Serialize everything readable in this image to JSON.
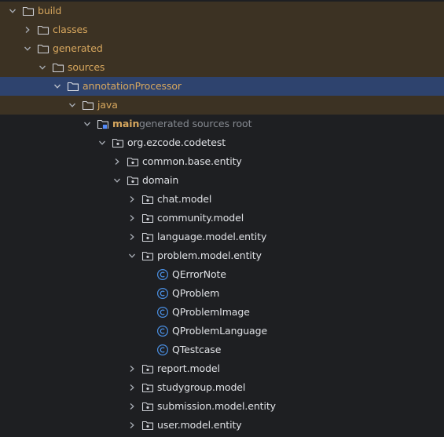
{
  "colors": {
    "background": "#1e1f22",
    "excluded_row": "#3c3223",
    "selected_row": "#2e436e",
    "excluded_text": "#d7a75e",
    "class_icon": "#4a8fe3",
    "hint_text": "#868a91"
  },
  "project_tree": {
    "build": {
      "label": "build",
      "icon": "folder-icon",
      "state": "expanded"
    },
    "classes": {
      "label": "classes",
      "icon": "folder-icon",
      "state": "collapsed"
    },
    "generated": {
      "label": "generated",
      "icon": "folder-icon",
      "state": "expanded"
    },
    "sources": {
      "label": "sources",
      "icon": "folder-icon",
      "state": "expanded"
    },
    "annotationProcessor": {
      "label": "annotationProcessor",
      "icon": "folder-icon",
      "state": "expanded",
      "selected": true
    },
    "java": {
      "label": "java",
      "icon": "folder-icon",
      "state": "expanded"
    },
    "main": {
      "label": "main",
      "hint": "generated sources root",
      "icon": "source-root-icon",
      "state": "expanded"
    },
    "org_ezcode_codetest": {
      "label": "org.ezcode.codetest",
      "icon": "package-icon",
      "state": "expanded"
    },
    "common_base_entity": {
      "label": "common.base.entity",
      "icon": "package-icon",
      "state": "collapsed"
    },
    "domain": {
      "label": "domain",
      "icon": "package-icon",
      "state": "expanded"
    },
    "chat_model": {
      "label": "chat.model",
      "icon": "package-icon",
      "state": "collapsed"
    },
    "community_model": {
      "label": "community.model",
      "icon": "package-icon",
      "state": "collapsed"
    },
    "language_model_entity": {
      "label": "language.model.entity",
      "icon": "package-icon",
      "state": "collapsed"
    },
    "problem_model_entity": {
      "label": "problem.model.entity",
      "icon": "package-icon",
      "state": "expanded"
    },
    "QErrorNote": {
      "label": "QErrorNote",
      "icon": "class-icon"
    },
    "QProblem": {
      "label": "QProblem",
      "icon": "class-icon"
    },
    "QProblemImage": {
      "label": "QProblemImage",
      "icon": "class-icon"
    },
    "QProblemLanguage": {
      "label": "QProblemLanguage",
      "icon": "class-icon"
    },
    "QTestcase": {
      "label": "QTestcase",
      "icon": "class-icon"
    },
    "report_model": {
      "label": "report.model",
      "icon": "package-icon",
      "state": "collapsed"
    },
    "studygroup_model": {
      "label": "studygroup.model",
      "icon": "package-icon",
      "state": "collapsed"
    },
    "submission_model_entity": {
      "label": "submission.model.entity",
      "icon": "package-icon",
      "state": "collapsed"
    },
    "user_model_entity": {
      "label": "user.model.entity",
      "icon": "package-icon",
      "state": "collapsed"
    }
  }
}
